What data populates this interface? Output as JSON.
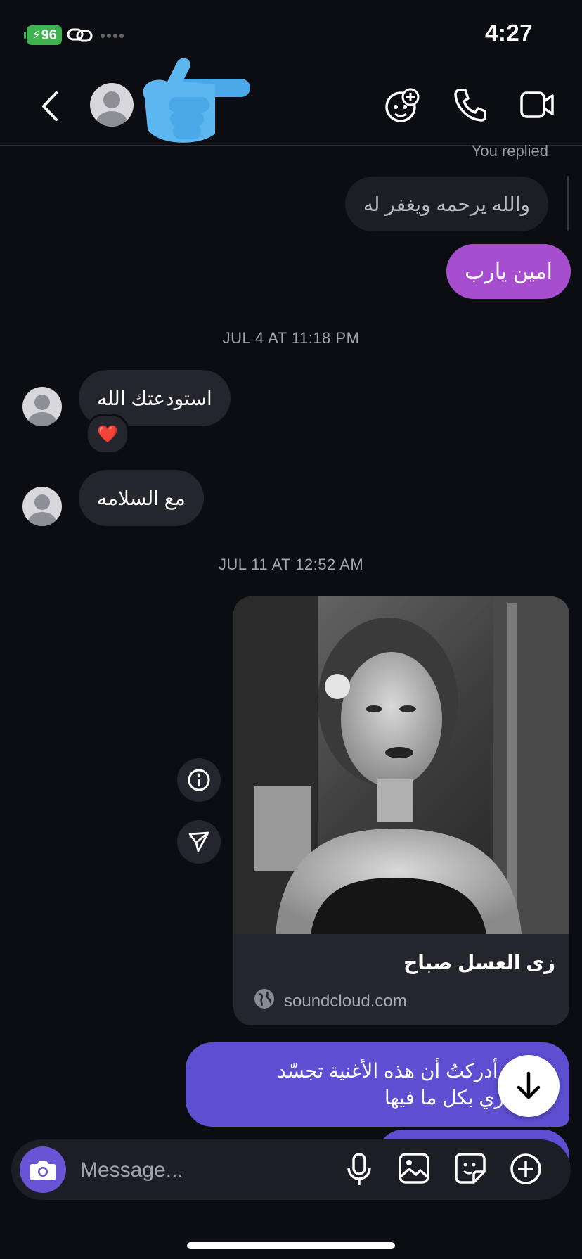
{
  "status_bar": {
    "time": "4:27",
    "battery": "96"
  },
  "header": {
    "back": "back",
    "icons": [
      "add-person-icon",
      "phone-icon",
      "video-icon"
    ]
  },
  "messages": {
    "you_replied": "You replied",
    "replied_to_text": "والله يرحمه ويغفر له",
    "sent_1": "امين يارب",
    "timestamp_1": "JUL 4 AT 11:18 PM",
    "received_1": "استودعتك الله",
    "reaction_1": "❤️",
    "received_2": "مع السلامه",
    "timestamp_2": "JUL 11 AT 12:52 AM",
    "link_card": {
      "title": "زى العسل صباح",
      "domain": "soundcloud.com"
    },
    "sent_long_line1": "حيلك، أدركتُ أن هذه الأغنية تجسّد",
    "sent_long_line2": "مشاعري بكل ما فيها"
  },
  "composer": {
    "placeholder": "Message..."
  },
  "colors": {
    "background": "#0c0c13",
    "sent_purple": "#a74ecf",
    "sent_indigo": "#5e4fd2",
    "camera": "#6a54d6"
  }
}
